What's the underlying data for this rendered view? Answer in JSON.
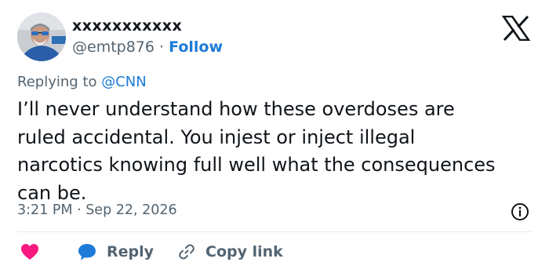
{
  "author": {
    "name": "xxxxxxxxxxx",
    "handle": "@emtp876",
    "separator": "·",
    "follow_label": "Follow"
  },
  "reply_context": {
    "prefix": "Replying to",
    "mention": "@CNN"
  },
  "tweet": {
    "text": "I’ll never understand how these overdoses are\nruled accidental. You injest or inject illegal\nnarcotics knowing full well what the consequences\ncan be.",
    "timestamp": "3:21 PM · Sep 22, 2026"
  },
  "actions": {
    "reply_label": "Reply",
    "copy_link_label": "Copy link"
  },
  "icons": {
    "logo": "x-logo-icon",
    "info": "info-icon",
    "like": "heart-icon",
    "reply": "speech-bubble-icon",
    "copy": "link-icon"
  },
  "colors": {
    "accent": "#1d7bd8",
    "like": "#f91880",
    "muted": "#536471",
    "text": "#0f1419"
  }
}
